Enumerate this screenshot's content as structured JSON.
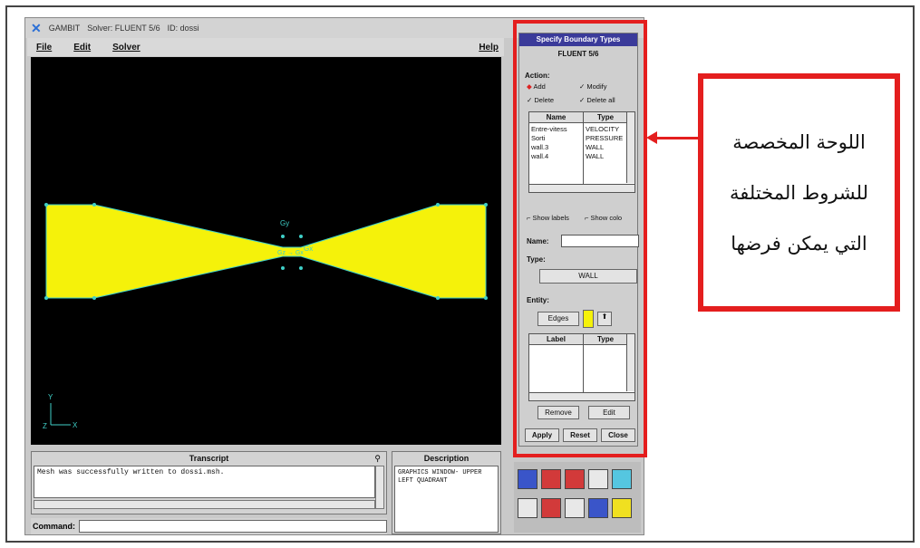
{
  "app": {
    "title_name": "GAMBIT",
    "solver_label": "Solver: FLUENT 5/6",
    "id_label": "ID: dossi"
  },
  "menu": {
    "file": "File",
    "edit": "Edit",
    "solver": "Solver",
    "help": "Help"
  },
  "viewport": {
    "labels": {
      "gy": "Gy",
      "gz_gx": "Gz → Gx",
      "gx": "Gx",
      "axis_y": "Y",
      "axis_z": "Z",
      "axis_x": "X"
    },
    "colors": {
      "background": "#000000",
      "mesh_fill": "#f5f20a",
      "vertex": "#3fd0c8"
    }
  },
  "transcript": {
    "title": "Transcript",
    "text": "Mesh was successfully written to dossi.msh.",
    "command_label": "Command:"
  },
  "description": {
    "title": "Description",
    "text": "GRAPHICS WINDOW- UPPER LEFT QUADRANT"
  },
  "panel": {
    "title": "Specify Boundary Types",
    "subtitle": "FLUENT 5/6",
    "action_label": "Action:",
    "actions": [
      "Add",
      "Modify",
      "Delete",
      "Delete all"
    ],
    "list_headers": [
      "Name",
      "Type"
    ],
    "rows": [
      {
        "name": "Entre-vitess",
        "type": "VELOCITY"
      },
      {
        "name": "Sorti",
        "type": "PRESSURE"
      },
      {
        "name": "wall.3",
        "type": "WALL"
      },
      {
        "name": "wall.4",
        "type": "WALL"
      }
    ],
    "show_labels": "Show labels",
    "show_colors": "Show colo",
    "name_label": "Name:",
    "type_label": "Type:",
    "type_value": "WALL",
    "entity_label": "Entity:",
    "entity_value": "Edges",
    "entity_headers": [
      "Label",
      "Type"
    ],
    "remove_label": "Remove",
    "edit_label": "Edit",
    "apply_label": "Apply",
    "reset_label": "Reset",
    "close_label": "Close"
  },
  "callout": {
    "lines": [
      "اللوحة المخصصة",
      "للشروط المختلفة",
      "التي يمكن فرضها"
    ],
    "color": "#e41e1e"
  }
}
